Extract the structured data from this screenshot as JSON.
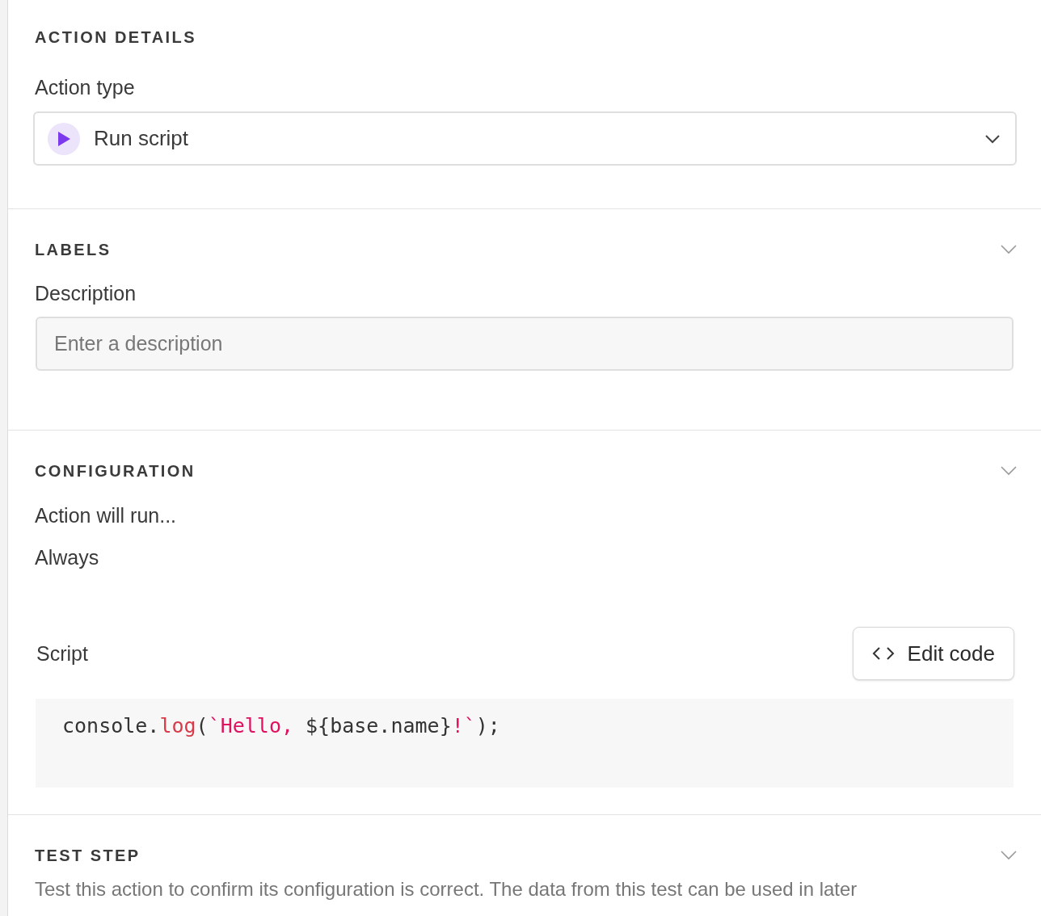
{
  "action_details": {
    "title": "ACTION DETAILS",
    "action_type_label": "Action type",
    "action_type": {
      "value": "Run script"
    }
  },
  "labels": {
    "title": "LABELS",
    "expanded": true,
    "description_label": "Description",
    "description": {
      "placeholder": "Enter a description"
    }
  },
  "configuration": {
    "title": "CONFIGURATION",
    "expanded": true,
    "run_label": "Action will run...",
    "run_value": "Always",
    "script_label": "Script",
    "edit_button": "Edit code",
    "code": [
      {
        "kind": "plain",
        "text": "console."
      },
      {
        "kind": "function",
        "text": "log"
      },
      {
        "kind": "plain",
        "text": "("
      },
      {
        "kind": "string",
        "text": "`Hello, "
      },
      {
        "kind": "plain",
        "text": "${base.name}"
      },
      {
        "kind": "string",
        "text": "!`"
      },
      {
        "kind": "plain",
        "text": ");"
      }
    ]
  },
  "test_step": {
    "title": "TEST STEP",
    "expanded": true,
    "text": "Test this action to confirm its configuration is correct. The data from this test can be used in later"
  }
}
